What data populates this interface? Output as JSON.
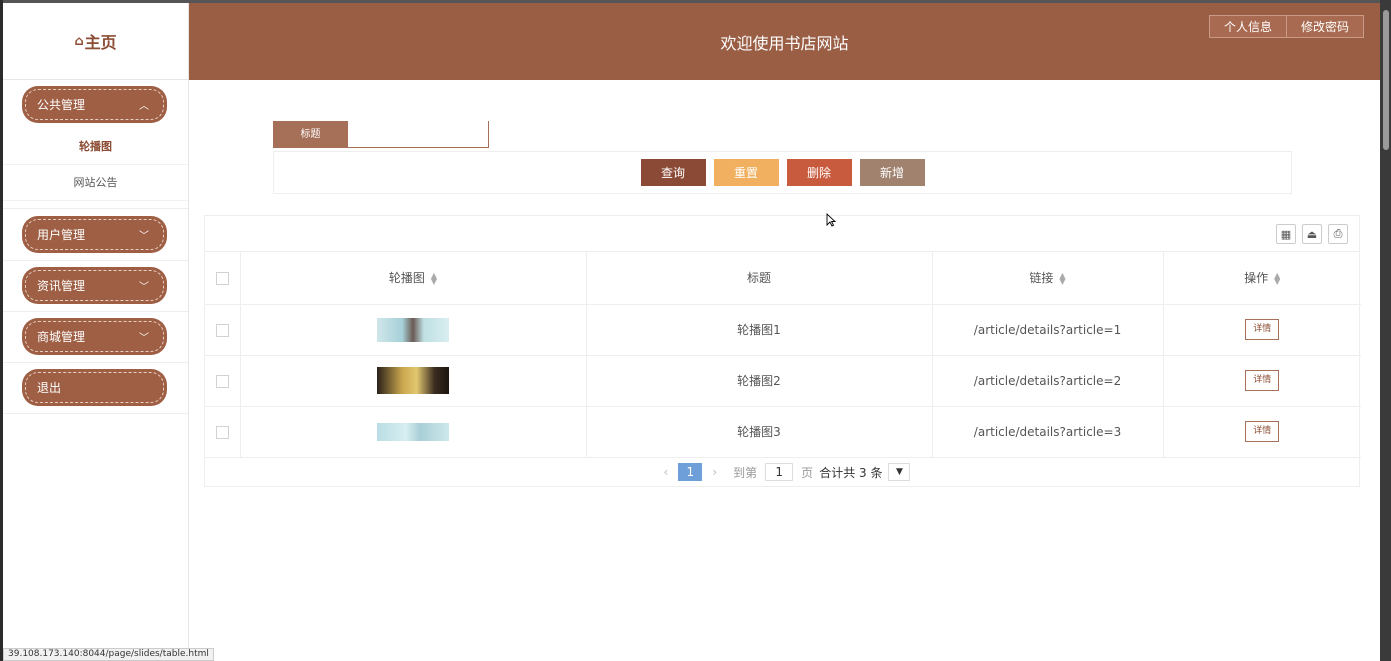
{
  "sidebar": {
    "logo": "主页",
    "groups": [
      {
        "label": "公共管理",
        "expanded": true,
        "items": [
          {
            "label": "轮播图",
            "active": true
          },
          {
            "label": "网站公告",
            "active": false
          }
        ]
      },
      {
        "label": "用户管理",
        "expanded": false
      },
      {
        "label": "资讯管理",
        "expanded": false
      },
      {
        "label": "商城管理",
        "expanded": false
      },
      {
        "label": "退出",
        "expanded": false
      }
    ]
  },
  "header": {
    "title": "欢迎使用书店网站",
    "buttons": [
      "个人信息",
      "修改密码"
    ]
  },
  "search": {
    "label": "标题",
    "value": ""
  },
  "actions": {
    "query": "查询",
    "reset": "重置",
    "delete": "删除",
    "add": "新增"
  },
  "table": {
    "columns": [
      "轮播图",
      "标题",
      "链接",
      "操作"
    ],
    "rows": [
      {
        "title": "轮播图1",
        "link": "/article/details?article=1",
        "action": "详情"
      },
      {
        "title": "轮播图2",
        "link": "/article/details?article=2",
        "action": "详情"
      },
      {
        "title": "轮播图3",
        "link": "/article/details?article=3",
        "action": "详情"
      }
    ]
  },
  "pager": {
    "current_page": "1",
    "goto_label": "到第",
    "page_input": "1",
    "page_unit": "页",
    "total": "合计共 3 条"
  },
  "status_url": "39.108.173.140:8044/page/slides/table.html",
  "colors": {
    "brand": "#9a5e45",
    "query": "#8b4a35",
    "reset": "#f0b060",
    "delete": "#c85a3e",
    "add": "#a0826f",
    "page_active": "#6f9fd8"
  }
}
